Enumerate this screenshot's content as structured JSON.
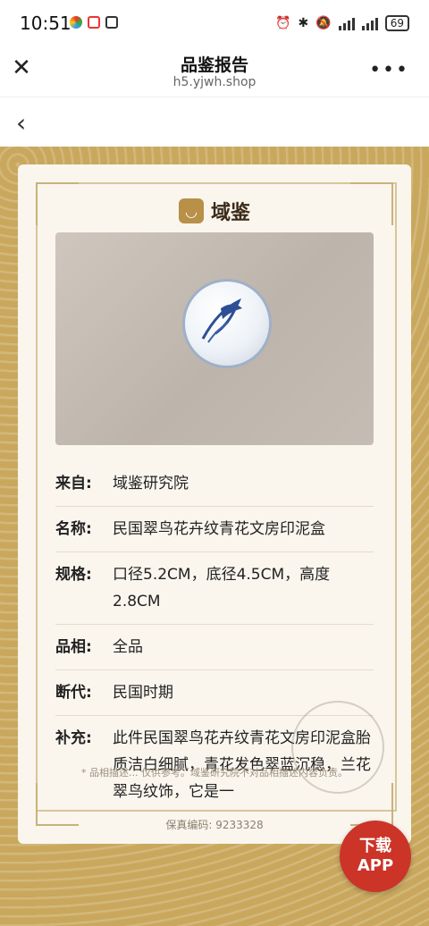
{
  "status": {
    "time": "10:51",
    "battery": "69"
  },
  "titlebar": {
    "title": "品鉴报告",
    "domain": "h5.yjwh.shop"
  },
  "brand": {
    "name": "域鉴"
  },
  "fields": [
    {
      "k": "来自:",
      "v": "域鉴研究院"
    },
    {
      "k": "名称:",
      "v": "民国翠鸟花卉纹青花文房印泥盒"
    },
    {
      "k": "规格:",
      "v": "口径5.2CM，底径4.5CM，高度2.8CM"
    },
    {
      "k": "品相:",
      "v": "全品"
    },
    {
      "k": "断代:",
      "v": "民国时期"
    },
    {
      "k": "补充:",
      "v": "此件民国翠鸟花卉纹青花文房印泥盒胎质洁白细腻，青花发色翠蓝沉稳，兰花翠鸟纹饰，它是一"
    }
  ],
  "note": {
    "line1": "* 品相描述... 仅供参考。域鉴研究院不对品相描述内容负责。"
  },
  "code": {
    "label": "保真编码:",
    "value": "9233328"
  },
  "download": {
    "line1": "下载",
    "line2": "APP"
  },
  "colors": {
    "gold": "#c9a85e",
    "card": "#faf6ee",
    "cta": "#cc3428"
  }
}
